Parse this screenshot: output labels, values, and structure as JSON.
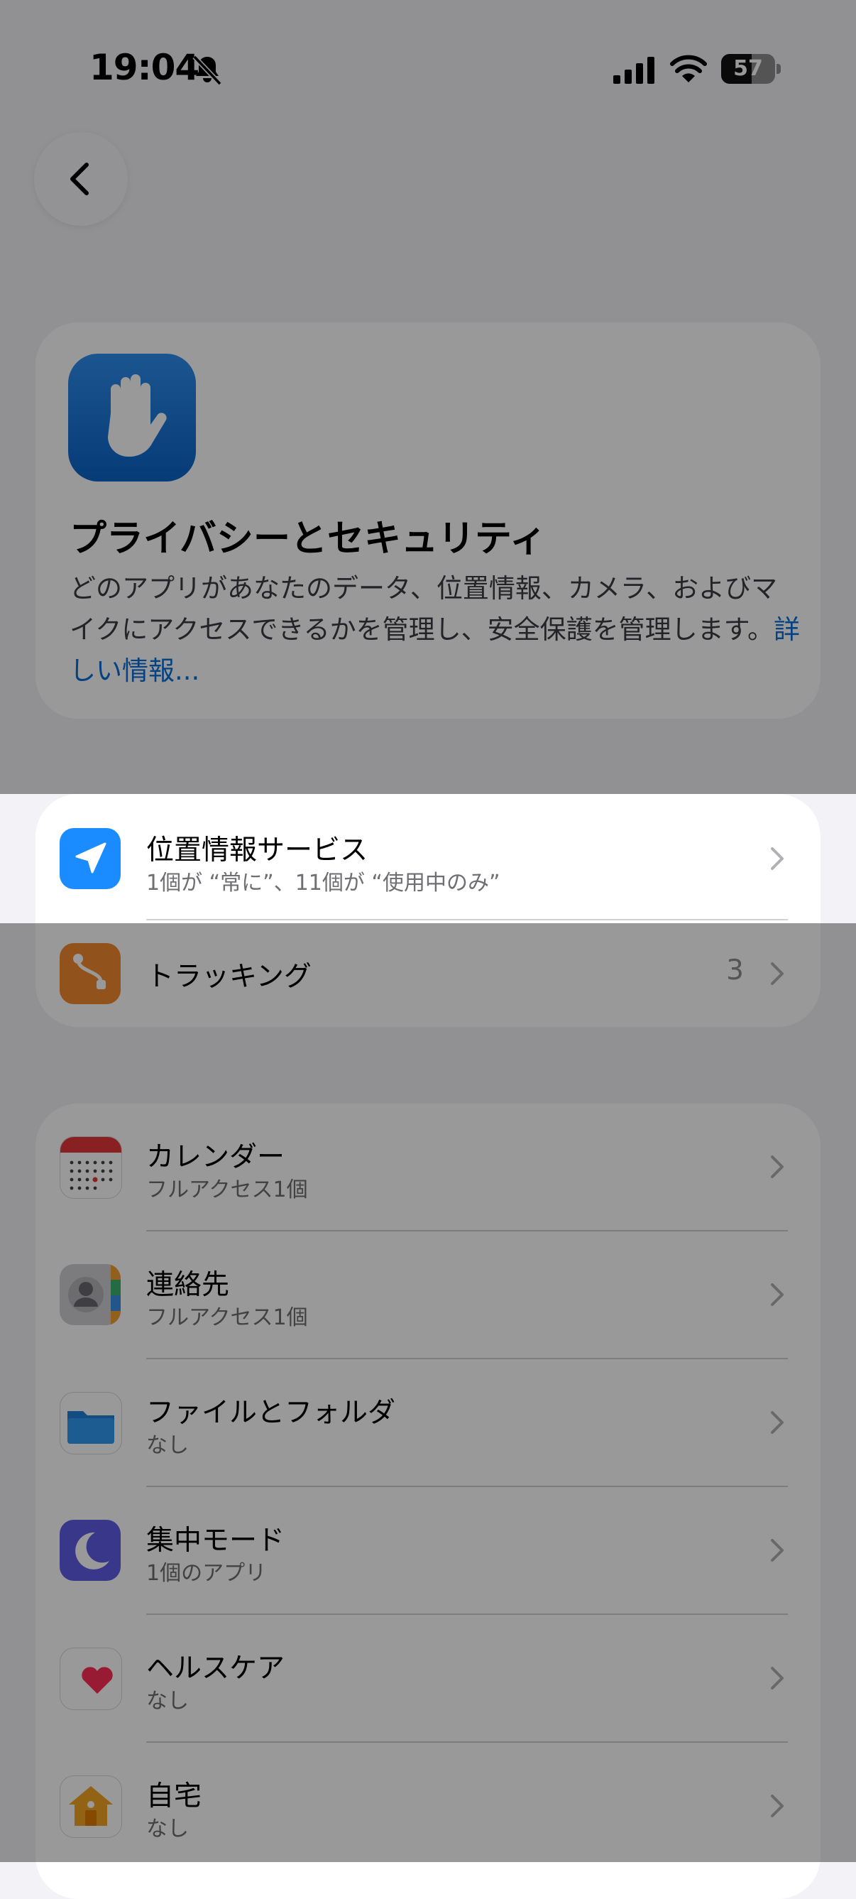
{
  "status": {
    "time": "19:04",
    "battery": "57"
  },
  "header": {
    "title": "プライバシーとセキュリティ",
    "description": "どのアプリがあなたのデータ、位置情報、カメラ、およびマイクにアクセスできるかを管理し、安全保護を管理します。",
    "learn_more": "詳しい情報..."
  },
  "group1": {
    "items": [
      {
        "label": "位置情報サービス",
        "sub": "1個が “常に”、11個が “使用中のみ”"
      },
      {
        "label": "トラッキング",
        "value": "3"
      }
    ]
  },
  "group2": {
    "items": [
      {
        "label": "カレンダー",
        "sub": "フルアクセス1個"
      },
      {
        "label": "連絡先",
        "sub": "フルアクセス1個"
      },
      {
        "label": "ファイルとフォルダ",
        "sub": "なし"
      },
      {
        "label": "集中モード",
        "sub": "1個のアプリ"
      },
      {
        "label": "ヘルスケア",
        "sub": "なし"
      },
      {
        "label": "自宅",
        "sub": "なし"
      }
    ]
  },
  "icons": {
    "status": [
      "bell-slash-icon",
      "cellular-signal-icon",
      "wifi-icon",
      "battery-icon"
    ],
    "back": "chevron-left-icon",
    "header": "hand-raised-icon",
    "rows": [
      "location-arrow-icon",
      "tracking-icon",
      "calendar-icon",
      "contacts-icon",
      "folder-icon",
      "moon-icon",
      "heart-icon",
      "home-icon"
    ]
  },
  "colors": {
    "accent": "#0a6fd8",
    "location": "#1a8cff",
    "tracking": "#f28a2e",
    "focus": "#5e5ce6",
    "dim_overlay": "rgba(0,0,0,0.4)"
  }
}
